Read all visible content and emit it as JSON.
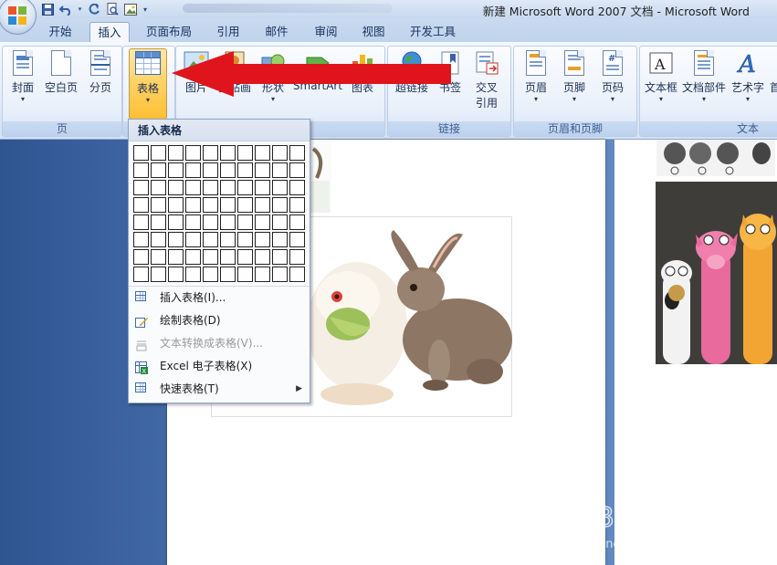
{
  "window": {
    "title": "新建 Microsoft Word 2007 文档 - Microsoft Word"
  },
  "quick_access": {
    "icons": [
      "save-icon",
      "undo-icon",
      "redo-icon",
      "print-preview-icon",
      "picture-icon",
      "customize-icon"
    ]
  },
  "tabs": [
    {
      "label": "开始"
    },
    {
      "label": "插入",
      "active": true
    },
    {
      "label": "页面布局"
    },
    {
      "label": "引用"
    },
    {
      "label": "邮件"
    },
    {
      "label": "审阅"
    },
    {
      "label": "视图"
    },
    {
      "label": "开发工具"
    }
  ],
  "ribbon": {
    "groups": {
      "pages": {
        "label": "页",
        "buttons": {
          "cover": "封面",
          "blank": "空白页",
          "break": "分页"
        }
      },
      "tables": {
        "button": "表格"
      },
      "illustrations": {
        "buttons": {
          "picture": "图片",
          "clipart": "剪贴画",
          "shapes": "形状",
          "smartart": "SmartArt",
          "chart": "图表"
        }
      },
      "links": {
        "label": "链接",
        "buttons": {
          "hyperlink": "超链接",
          "bookmark": "书签",
          "crossref_line1": "交叉",
          "crossref_line2": "引用"
        }
      },
      "header_footer": {
        "label": "页眉和页脚",
        "buttons": {
          "header": "页眉",
          "footer": "页脚",
          "pagenum": "页码"
        }
      },
      "text": {
        "label": "文本",
        "buttons": {
          "textbox": "文本框",
          "quickparts": "文档部件",
          "wordart": "艺术字",
          "dropcap": "首"
        }
      }
    }
  },
  "table_dropdown": {
    "header": "插入表格",
    "grid": {
      "columns": 10,
      "rows": 8
    },
    "items": [
      {
        "label": "插入表格(I)...",
        "icon": "insert-table-icon",
        "enabled": true
      },
      {
        "label": "绘制表格(D)",
        "icon": "draw-table-icon",
        "enabled": true
      },
      {
        "label": "文本转换成表格(V)...",
        "icon": "convert-text-icon",
        "enabled": false
      },
      {
        "label": "Excel 电子表格(X)",
        "icon": "excel-icon",
        "enabled": true
      },
      {
        "label": "快速表格(T)",
        "icon": "quick-table-icon",
        "enabled": true,
        "submenu": true
      }
    ]
  },
  "watermark": {
    "brand": "Baidu 经验",
    "url": "jingyan.baidu.com"
  },
  "colors": {
    "arrow": "#e0141c",
    "active_button": "#ffd36a",
    "ribbon": "#e4edf9"
  }
}
